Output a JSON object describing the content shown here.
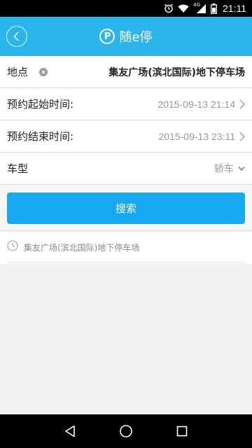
{
  "status_bar": {
    "time": "21:11",
    "network_label": "4G",
    "icons": [
      "alarm-icon",
      "wifi-icon",
      "signal-icon",
      "battery-icon"
    ]
  },
  "app_bar": {
    "logo_letter": "P",
    "title": "随e停",
    "back_icon": "chevron-left-icon",
    "color": "#2bb5ee"
  },
  "form": {
    "location": {
      "label": "地点",
      "value": "集友广场(滨北国际)地下停车场"
    },
    "start_time": {
      "label": "预约起始时间:",
      "value": "2015-09-13 21:14"
    },
    "end_time": {
      "label": "预约结束时间:",
      "value": "2015-09-13 23:11"
    },
    "car_type": {
      "label": "车型",
      "value": "轿车"
    }
  },
  "search": {
    "button_label": "搜索",
    "color": "#16a8f0"
  },
  "history": {
    "items": [
      {
        "text": "集友广场(滨北国际)地下停车场",
        "icon": "clock-icon"
      }
    ]
  },
  "nav": {
    "icons": [
      "back-triangle-icon",
      "home-circle-icon",
      "recents-square-icon"
    ]
  }
}
